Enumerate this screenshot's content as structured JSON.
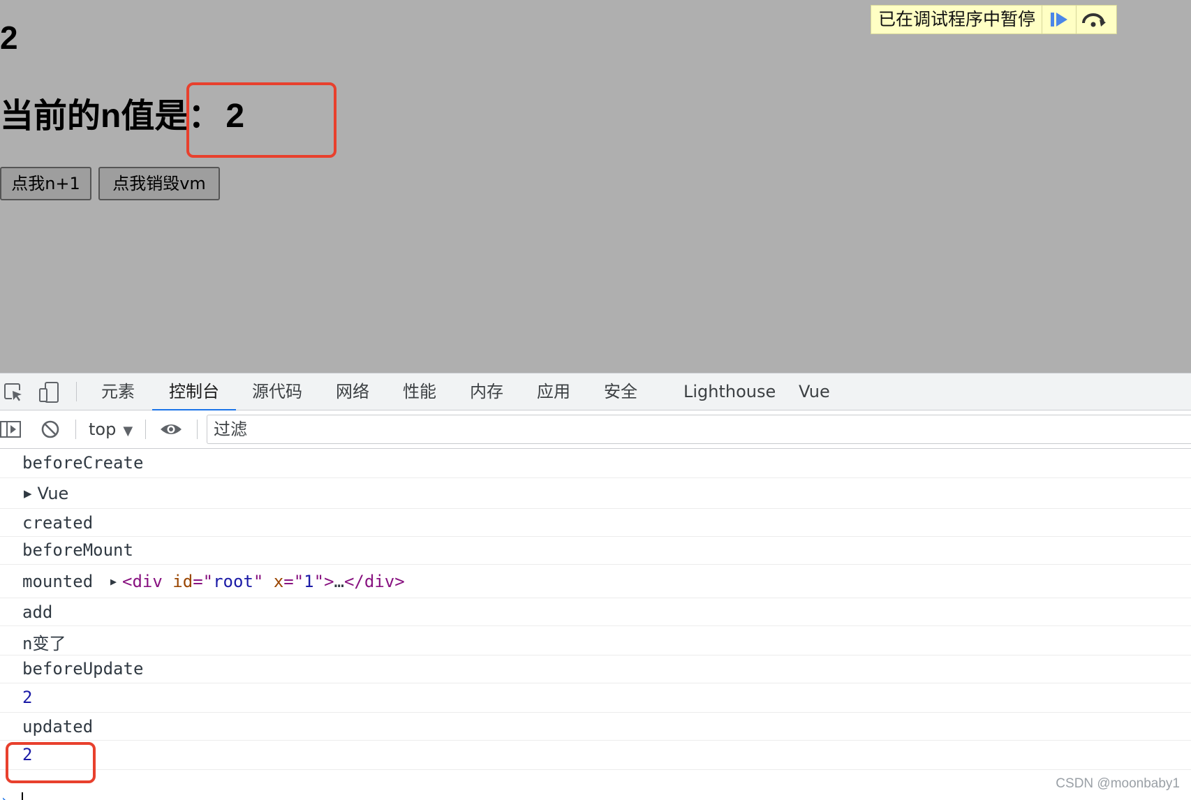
{
  "page": {
    "counter_value": "2",
    "heading_label": "当前的n值是：",
    "heading_value": "2",
    "increment_button": "点我n+1",
    "destroy_button": "点我销毁vm"
  },
  "debugger_overlay": {
    "label": "已在调试程序中暂停",
    "resume_icon": "resume-icon",
    "step_over_icon": "step-over-icon"
  },
  "devtools": {
    "tabs": [
      {
        "label": "元素",
        "active": false
      },
      {
        "label": "控制台",
        "active": true
      },
      {
        "label": "源代码",
        "active": false
      },
      {
        "label": "网络",
        "active": false
      },
      {
        "label": "性能",
        "active": false
      },
      {
        "label": "内存",
        "active": false
      },
      {
        "label": "应用",
        "active": false
      },
      {
        "label": "安全",
        "active": false
      },
      {
        "label": "Lighthouse",
        "active": false
      },
      {
        "label": "Vue",
        "active": false
      }
    ],
    "accent_color": "#1a73e8",
    "toolbar": {
      "context": "top",
      "filter_placeholder": "过滤"
    },
    "console": {
      "logs": [
        {
          "text": "beforeCreate"
        },
        {
          "text": "Vue",
          "expandable": true
        },
        {
          "text": "created"
        },
        {
          "text": "beforeMount"
        },
        {
          "text": "mounted",
          "element_tag": "div",
          "attributes": [
            {
              "name": "id",
              "value": "root"
            },
            {
              "name": "x",
              "value": "1"
            }
          ],
          "ellipsis": "…",
          "closing": "</div>"
        },
        {
          "text": "add"
        },
        {
          "text": "n变了"
        },
        {
          "text": "beforeUpdate"
        },
        {
          "text": "2",
          "type": "number"
        },
        {
          "text": "updated"
        },
        {
          "text": "2",
          "type": "number"
        }
      ]
    }
  },
  "highlight_color": "#e8402d",
  "watermark": "CSDN @moonbaby1"
}
